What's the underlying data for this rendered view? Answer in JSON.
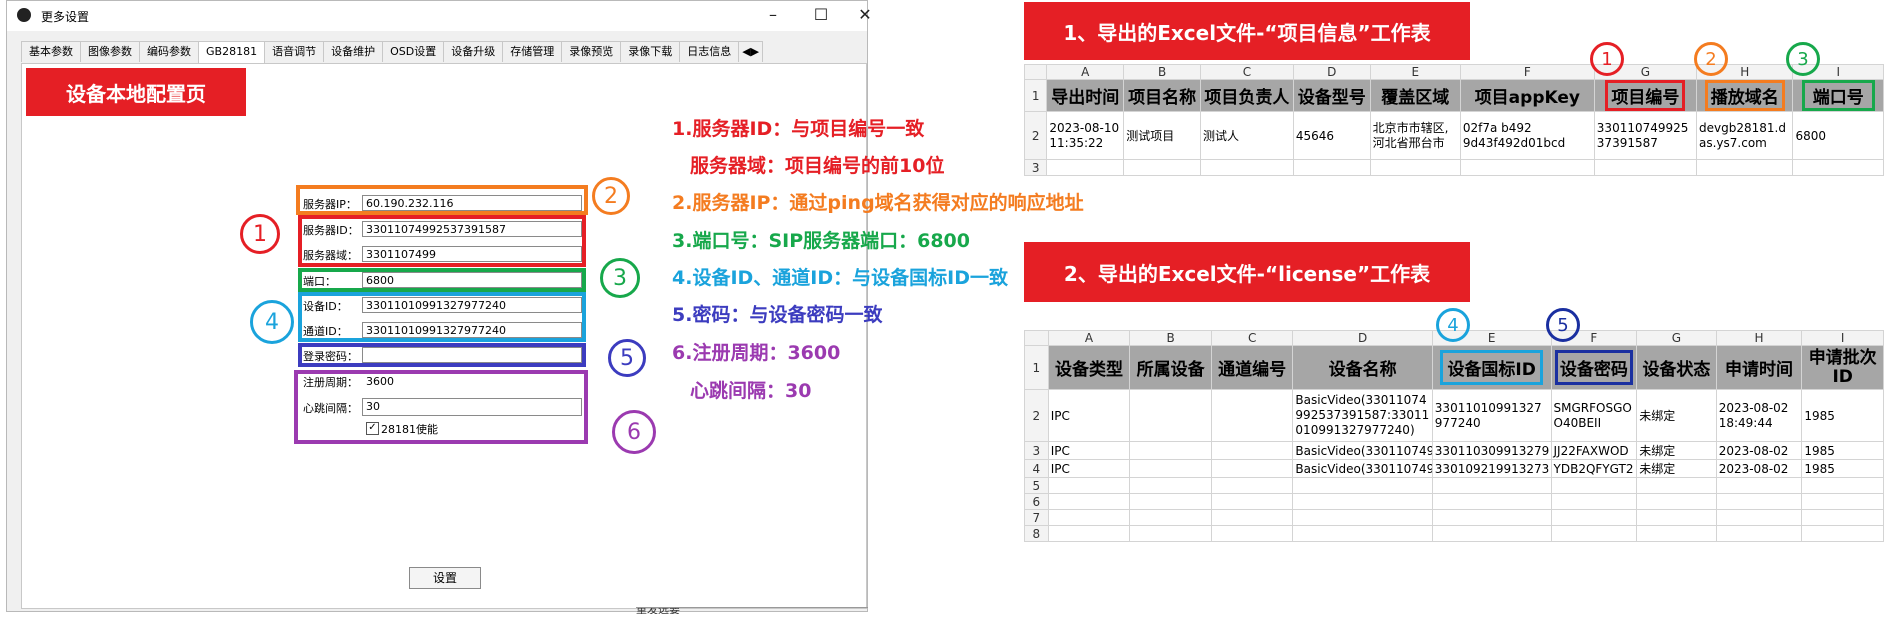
{
  "window": {
    "title": "更多设置",
    "tabs": [
      "基本参数",
      "图像参数",
      "编码参数",
      "GB28181",
      "语音调节",
      "设备维护",
      "OSD设置",
      "设备升级",
      "存储管理",
      "录像预览",
      "录像下载",
      "日志信息"
    ],
    "banner": "设备本地配置页",
    "fields": {
      "server_ip": {
        "label": "服务器IP：",
        "value": "60.190.232.116"
      },
      "server_id": {
        "label": "服务器ID：",
        "value": "33011074992537391587"
      },
      "server_domain": {
        "label": "服务器域：",
        "value": "3301107499"
      },
      "port": {
        "label": "端口：",
        "value": "6800"
      },
      "device_id": {
        "label": "设备ID：",
        "value": "33011010991327977240"
      },
      "channel_id": {
        "label": "通道ID：",
        "value": "33011010991327977240"
      },
      "password": {
        "label": "登录密码：",
        "value": ""
      },
      "register_period": {
        "label": "注册周期：",
        "value": "3600"
      },
      "heartbeat": {
        "label": "心跳间隔：",
        "value": "30"
      },
      "enable_label": "28181使能"
    },
    "set_button": "设置",
    "bottom_text": "重发选要"
  },
  "markers": [
    "1",
    "2",
    "3",
    "4",
    "5",
    "6"
  ],
  "notes": {
    "n1": "1.服务器ID：与项目编号一致",
    "n1b": "服务器域：项目编号的前10位",
    "n2": "2.服务器IP：通过ping域名获得对应的响应地址",
    "n3": "3.端口号：SIP服务器端口：6800",
    "n4": "4.设备ID、通道ID：与设备国标ID一致",
    "n5": "5.密码：与设备密码一致",
    "n6": "6.注册周期：3600",
    "n6b": "心跳间隔：30"
  },
  "colors": {
    "red": "#e51f25",
    "orange": "#f47c20",
    "green": "#17a84b",
    "cyan": "#1aa3dc",
    "blue": "#3c3cbf",
    "purple": "#9b3ab0"
  },
  "sheet1": {
    "banner": "1、导出的Excel文件-“项目信息”工作表",
    "columns": [
      "A",
      "B",
      "C",
      "D",
      "E",
      "F",
      "G",
      "H",
      "I"
    ],
    "headers": [
      "导出时间",
      "项目名称",
      "项目负责人",
      "设备型号",
      "覆盖区域",
      "项目appKey",
      "项目编号",
      "播放域名",
      "端口号"
    ],
    "row2": [
      "2023-08-10 11:35:22",
      "测试项目",
      "测试人",
      "45646",
      "北京市市辖区,河北省邢台市",
      "02f7a b492 9d43f492d01bcd",
      "33011074992537391587",
      "devgb28181.das.ys7.com",
      "6800"
    ],
    "row_numbers": [
      "1",
      "2",
      "3"
    ]
  },
  "sheet2": {
    "banner": "2、导出的Excel文件-“license”工作表",
    "columns": [
      "A",
      "B",
      "C",
      "D",
      "E",
      "F",
      "G",
      "H",
      "I"
    ],
    "headers": [
      "设备类型",
      "所属设备",
      "通道编号",
      "设备名称",
      "设备国标ID",
      "设备密码",
      "设备状态",
      "申请时间",
      "申请批次ID"
    ],
    "rows": [
      [
        "IPC",
        "",
        "",
        "BasicVideo(33011074992537391587:33011010991327977240)",
        "33011010991327977240",
        "SMGRFOSGOO40BEII",
        "未绑定",
        "2023-08-02 18:49:44",
        "1985"
      ],
      [
        "IPC",
        "",
        "",
        "BasicVideo(330110749",
        "330110309913279",
        "JJ22FAXWOD",
        "未绑定",
        "2023-08-02",
        "1985"
      ],
      [
        "IPC",
        "",
        "",
        "BasicVideo(330110749",
        "330109219913273",
        "YDB2QFYGT2",
        "未绑定",
        "2023-08-02",
        "1985"
      ]
    ],
    "row_numbers": [
      "1",
      "2",
      "3",
      "4",
      "5",
      "6",
      "7",
      "8"
    ]
  }
}
